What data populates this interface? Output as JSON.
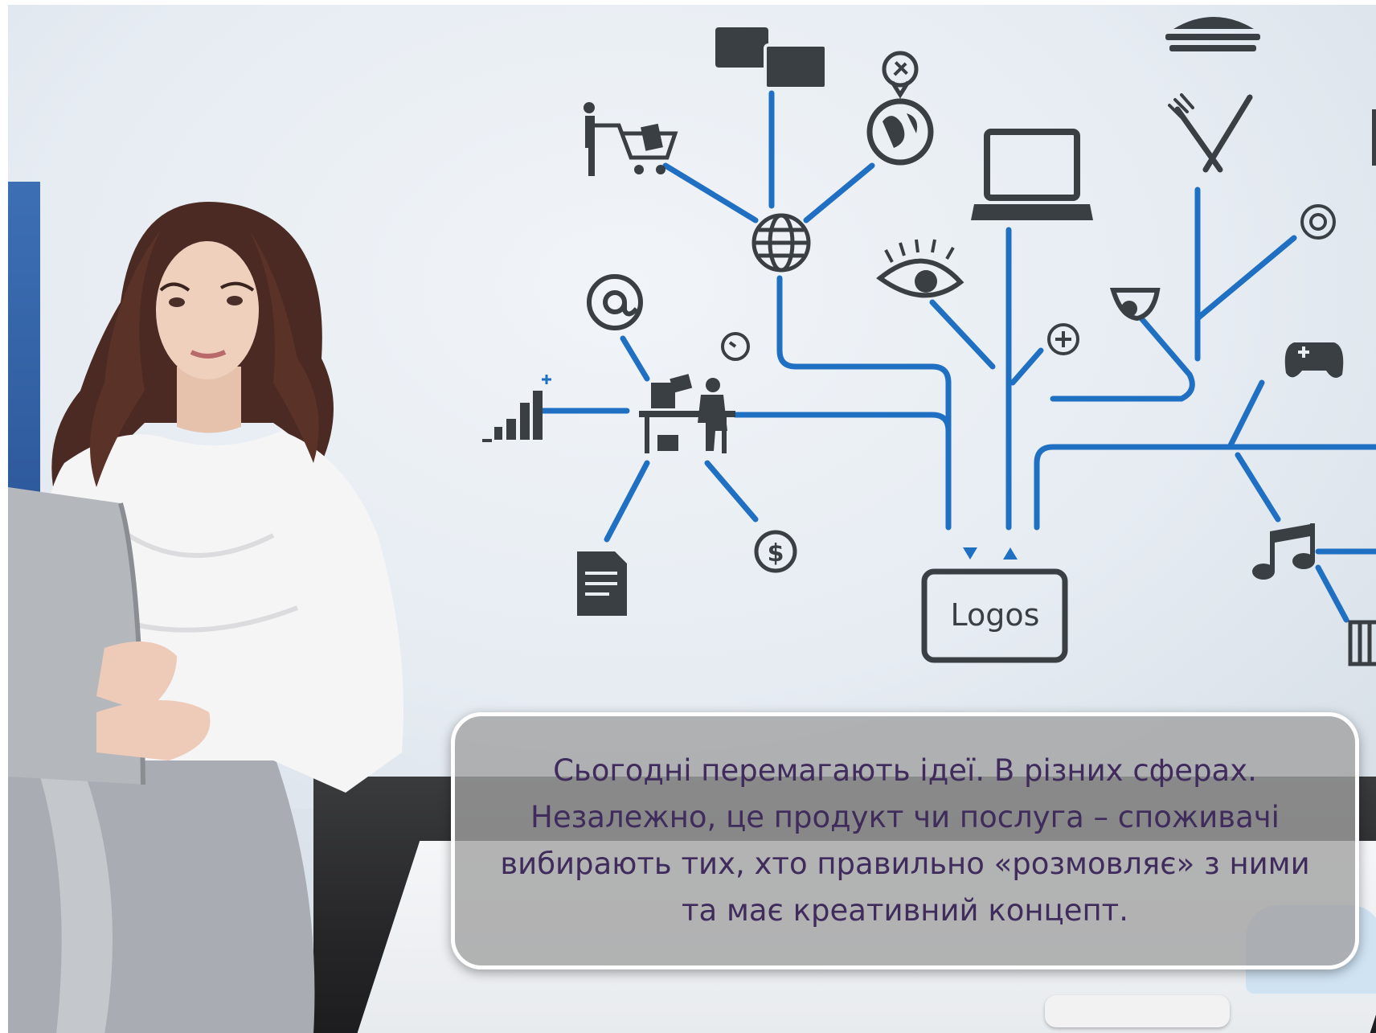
{
  "diagram": {
    "hub_label": "Logos"
  },
  "caption": {
    "lines": [
      "Сьогодні перемагають ідеї. В різних сферах.",
      "Незалежно, це продукт чи послуга – споживачі",
      "вибирають тих, хто правильно «розмовляє» з ними",
      "та має креативний концепт."
    ]
  },
  "colors": {
    "line_blue": "#1f6fc2",
    "icon_dark": "#3a3f44",
    "caption_text": "#3f2b5c",
    "caption_bg": "#a0a0a0"
  },
  "icons": [
    "shopping-cart-person-icon",
    "chat-bubbles-icon",
    "map-pin-icon",
    "globe-icon",
    "at-sign-icon",
    "clock-icon",
    "bar-chart-icon",
    "office-desk-icon",
    "document-icon",
    "dollar-icon",
    "laptop-icon",
    "eye-icon",
    "plus-circle-icon",
    "fork-knife-icon",
    "target-icon",
    "game-controller-icon",
    "music-note-icon",
    "piano-keys-icon",
    "burger-icon",
    "hub-box-icon"
  ]
}
